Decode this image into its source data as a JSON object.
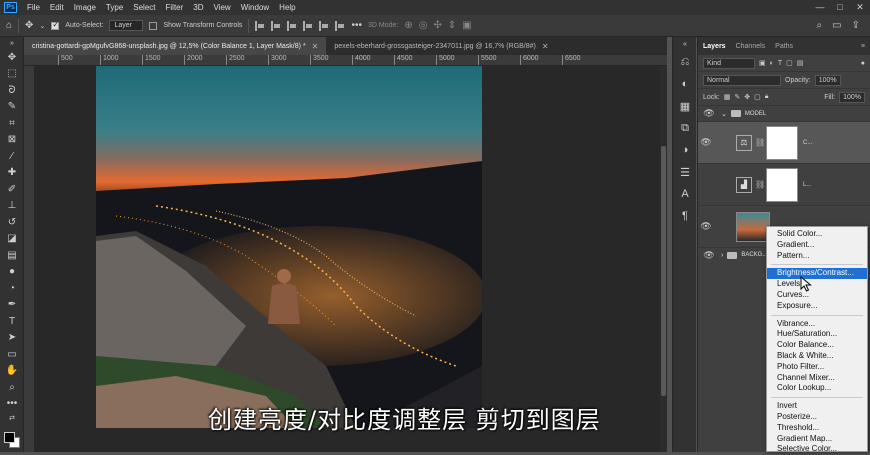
{
  "app": {
    "logo": "Ps"
  },
  "menubar": {
    "items": [
      "File",
      "Edit",
      "Image",
      "Type",
      "Select",
      "Filter",
      "3D",
      "View",
      "Window",
      "Help"
    ],
    "window_controls": [
      "—",
      "□",
      "✕"
    ]
  },
  "options_bar": {
    "auto_select_label": "Auto-Select:",
    "auto_select_value": "Layer",
    "transform_label": "Show Transform Controls",
    "mode_3d_label": "3D Mode:",
    "more_label": "•••"
  },
  "tabs": [
    {
      "label": "cristina-gottardi-gpMgufvG868-unsplash.jpg @ 12,5% (Color Balance 1, Layer Mask/8) *",
      "close": "✕"
    },
    {
      "label": "pexels-eberhard-grossgasteiger-2347011.jpg @ 16,7% (RGB/8#)",
      "close": "✕"
    }
  ],
  "ruler_marks": [
    "500",
    "1000",
    "1500",
    "2000",
    "2500",
    "3000",
    "3500",
    "4000",
    "4500",
    "5000",
    "5500",
    "6000",
    "6500"
  ],
  "layers_panel": {
    "tabs": [
      "Layers",
      "Channels",
      "Paths"
    ],
    "kind_label": "Kind",
    "blend_mode": "Normal",
    "opacity_label": "Opacity:",
    "opacity_value": "100%",
    "lock_label": "Lock:",
    "fill_label": "Fill:",
    "fill_value": "100%",
    "group_name": "MODEL",
    "layer1_suffix": "C...",
    "layer2_suffix": "L...",
    "background_name": "BACKG..."
  },
  "context_menu": {
    "group1": [
      "Solid Color...",
      "Gradient...",
      "Pattern..."
    ],
    "group2": [
      "Brightness/Contrast...",
      "Levels...",
      "Curves...",
      "Exposure..."
    ],
    "group3": [
      "Vibrance...",
      "Hue/Saturation...",
      "Color Balance...",
      "Black & White...",
      "Photo Filter...",
      "Channel Mixer...",
      "Color Lookup..."
    ],
    "group4": [
      "Invert",
      "Posterize...",
      "Threshold...",
      "Gradient Map...",
      "Selective Color..."
    ],
    "highlighted": "Brightness/Contrast..."
  },
  "subtitle": "创建亮度/对比度调整层 剪切到图层",
  "colors": {
    "highlight": "#1f6fd4",
    "ps_blue": "#31a8ff"
  }
}
